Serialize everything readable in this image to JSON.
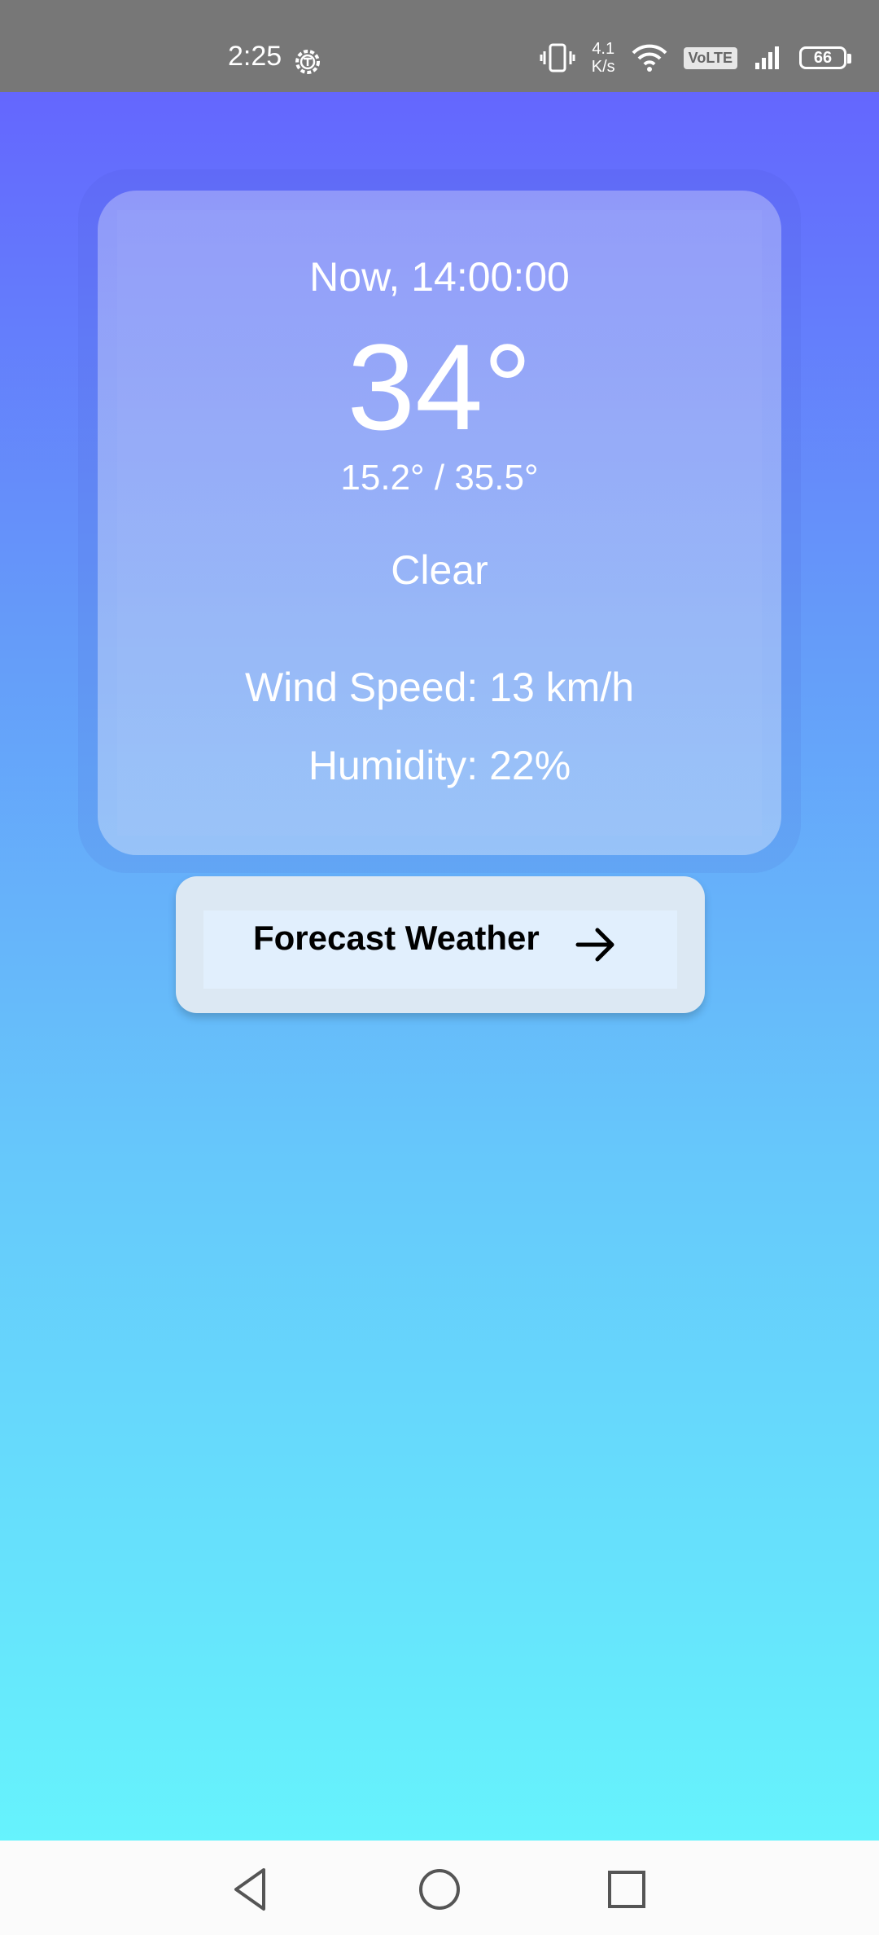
{
  "status_bar": {
    "time": "2:25",
    "net_speed_value": "4.1",
    "net_speed_unit": "K/s",
    "volte": "VoLTE",
    "battery": "66"
  },
  "weather": {
    "now_time": "Now, 14:00:00",
    "temperature": "34°",
    "min_max": "15.2° / 35.5°",
    "condition": "Clear",
    "wind_speed": "Wind Speed: 13 km/h",
    "humidity": "Humidity: 22%"
  },
  "forecast_button": {
    "label": "Forecast Weather"
  },
  "icons": {
    "settings": "gear-icon",
    "vibrate": "vibrate-icon",
    "wifi": "wifi-icon",
    "signal": "signal-icon",
    "arrow": "arrow-right-icon",
    "back": "back-triangle-icon",
    "home": "home-circle-icon",
    "recent": "recent-square-icon"
  },
  "colors": {
    "gradient_top": "#6465fe",
    "gradient_bottom": "#66f9fd",
    "status_bar": "#777777",
    "button_bg": "#dce8f3"
  }
}
